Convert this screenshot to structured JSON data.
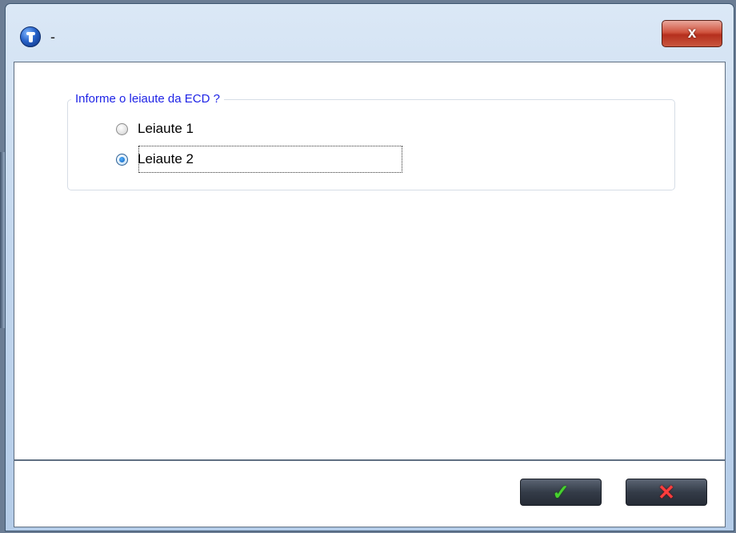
{
  "window": {
    "title": "-",
    "close_symbol": "x",
    "app_icon": "totvs-logo-icon",
    "close_color": "#c9412b"
  },
  "group": {
    "legend": "Informe o leiaute da ECD  ?",
    "options": [
      {
        "label": "Leiaute 1",
        "selected": false
      },
      {
        "label": "Leiaute 2",
        "selected": true
      }
    ]
  },
  "footer": {
    "ok_icon": "check-icon",
    "ok_symbol": "✓",
    "cancel_icon": "cross-icon",
    "cancel_symbol": "✕"
  },
  "colors": {
    "legend_text": "#1f24e6",
    "ok_check": "#47d12f",
    "cancel_cross": "#ff3d3d"
  }
}
